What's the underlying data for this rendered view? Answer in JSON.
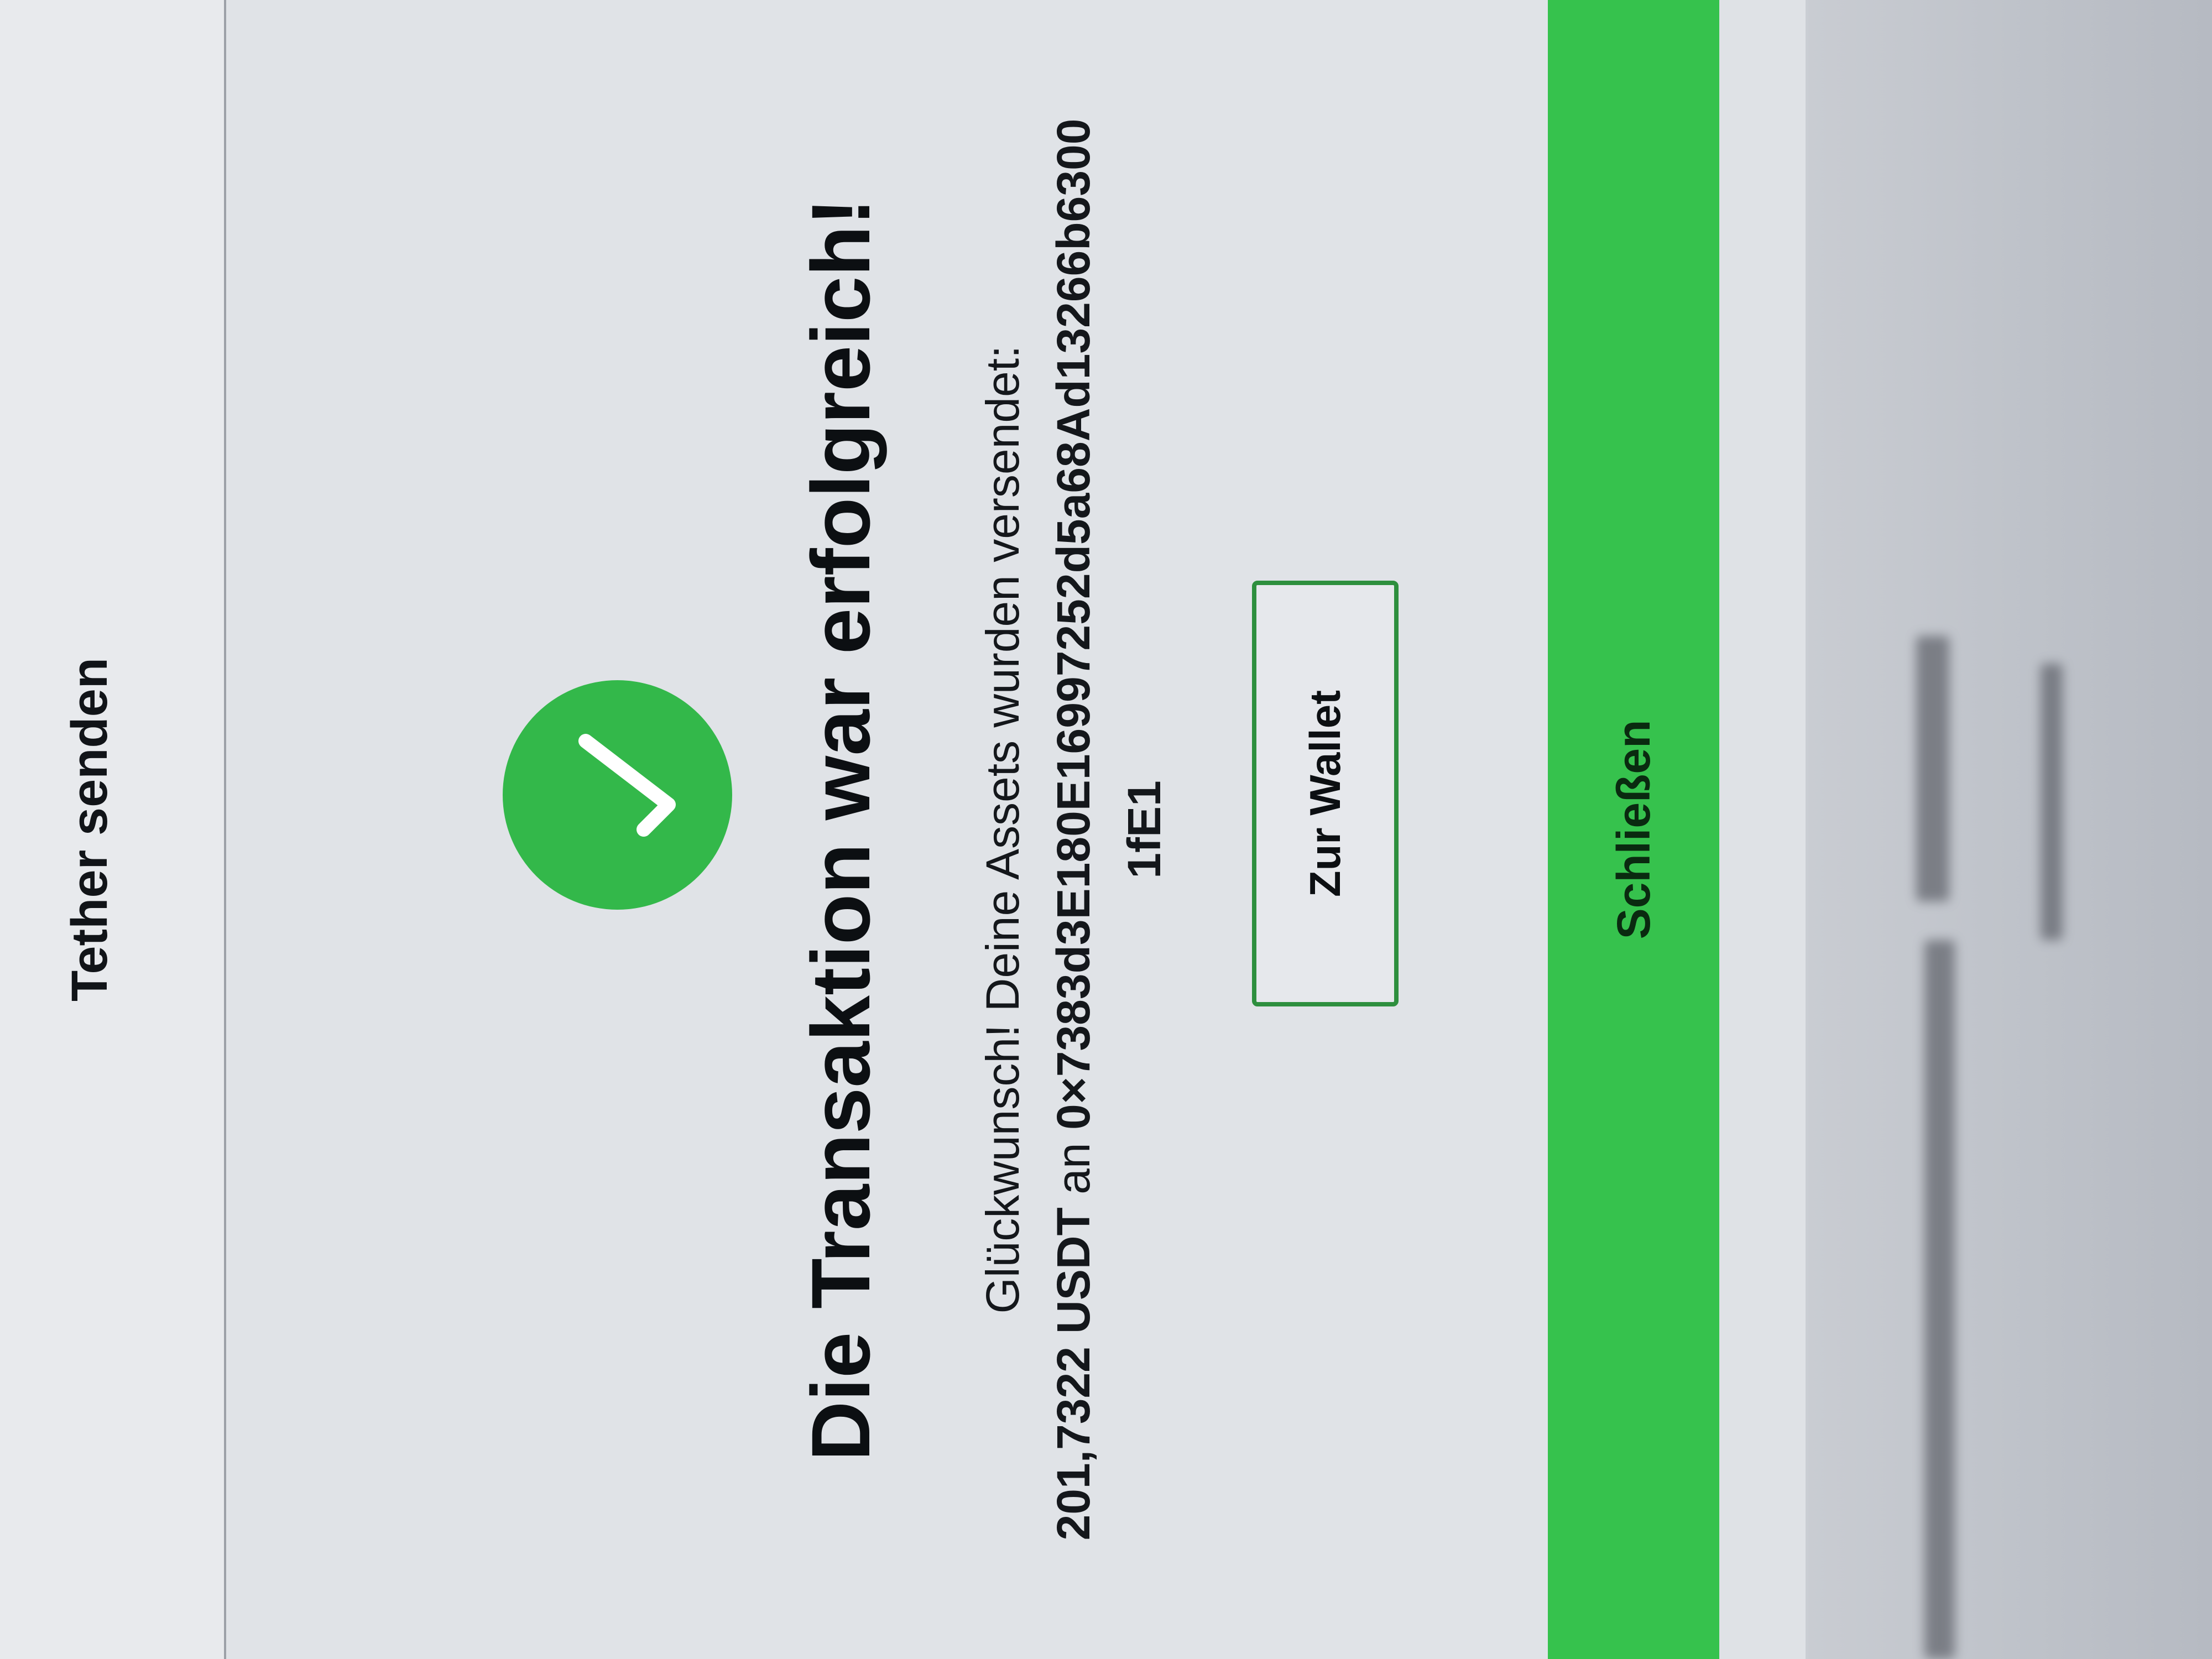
{
  "header": {
    "title": "Tether senden"
  },
  "success": {
    "icon": "checkmark-icon",
    "icon_color": "#33b84a",
    "title": "Die Transaktion war erfolgreich!",
    "message_intro": "Glückwunsch! Deine Assets wurden versendet:",
    "amount": "201,7322 USDT",
    "connector": "an",
    "address": "0×7383d3E180E16997252d5a68Ad13266b63001fE1"
  },
  "buttons": {
    "wallet_label": "Zur Wallet",
    "close_label": "Schließen"
  },
  "colors": {
    "accent": "#36c24d",
    "button_border": "#2e8f3e"
  }
}
